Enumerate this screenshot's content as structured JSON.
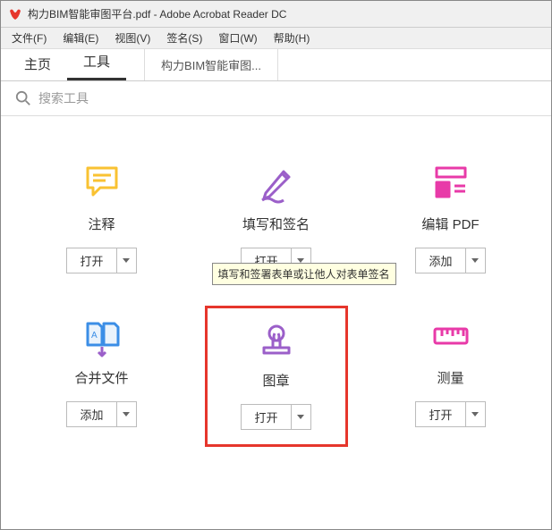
{
  "window": {
    "title": "构力BIM智能审图平台.pdf - Adobe Acrobat Reader DC"
  },
  "menu": {
    "file": "文件(F)",
    "edit": "编辑(E)",
    "view": "视图(V)",
    "sign": "签名(S)",
    "window": "窗口(W)",
    "help": "帮助(H)"
  },
  "tabs": {
    "home": "主页",
    "tools": "工具",
    "doc": "构力BIM智能审图..."
  },
  "search": {
    "placeholder": "搜索工具"
  },
  "tools": [
    {
      "label": "注释",
      "action": "打开"
    },
    {
      "label": "填写和签名",
      "action": "打开",
      "tooltip": "填写和签署表单或让他人对表单签名"
    },
    {
      "label": "编辑 PDF",
      "action": "添加"
    },
    {
      "label": "合并文件",
      "action": "添加"
    },
    {
      "label": "图章",
      "action": "打开"
    },
    {
      "label": "测量",
      "action": "打开"
    }
  ],
  "colors": {
    "accent_yellow": "#f9c232",
    "accent_purple": "#9b5fc9",
    "accent_pink": "#e83aa8",
    "accent_blue": "#3b8ee6",
    "highlight_red": "#e6362c"
  }
}
